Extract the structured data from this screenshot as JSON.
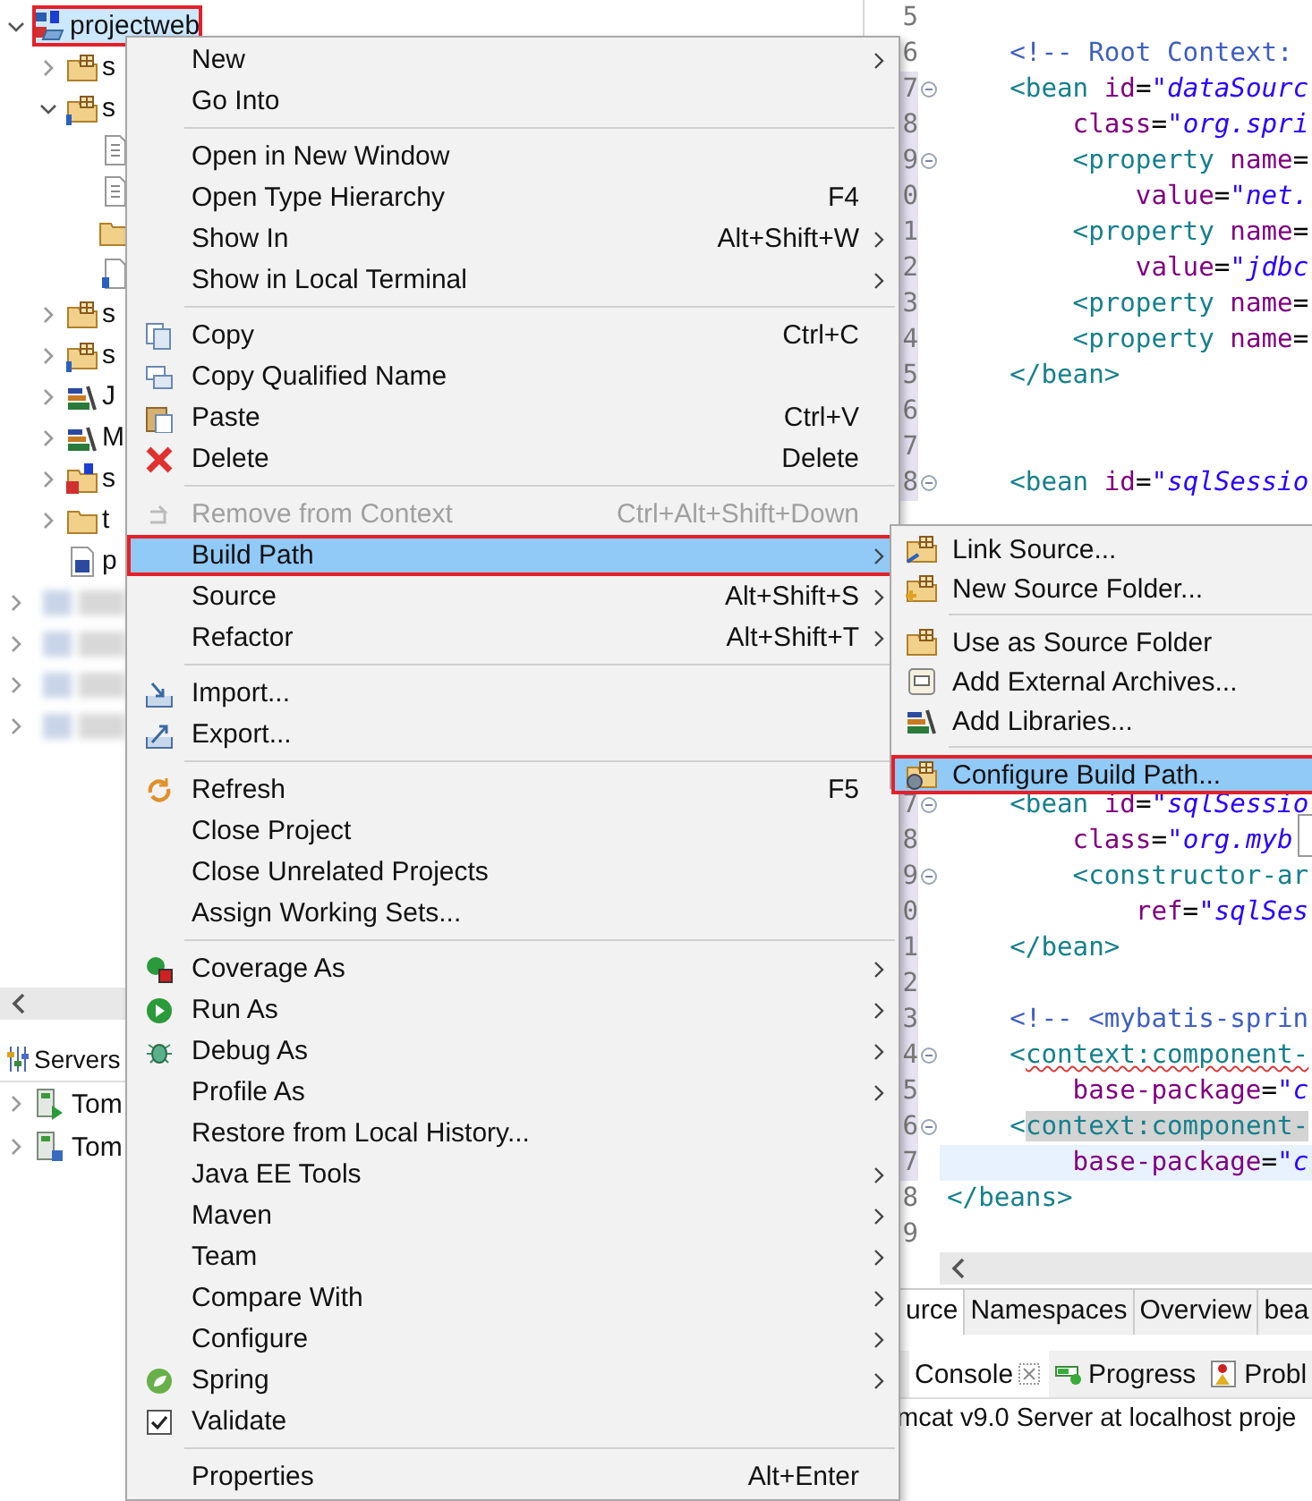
{
  "project_explorer": {
    "tree": [
      {
        "label": "projectweb",
        "kind": "project",
        "expanded": true,
        "selected": true,
        "outlined": true,
        "children": [
          {
            "label": "s",
            "kind": "package-root",
            "expanded": false
          },
          {
            "label": "s",
            "kind": "package-root-info",
            "expanded": true,
            "children": [
              {
                "kind": "file"
              },
              {
                "kind": "file"
              },
              {
                "kind": "folder"
              },
              {
                "kind": "config-file"
              }
            ]
          },
          {
            "label": "s",
            "kind": "package-root",
            "expanded": false
          },
          {
            "label": "s",
            "kind": "package-root-info",
            "expanded": false
          },
          {
            "label": "J",
            "kind": "library",
            "expanded": false
          },
          {
            "label": "M",
            "kind": "library",
            "expanded": false
          },
          {
            "label": "s",
            "kind": "spring-folder",
            "expanded": false
          },
          {
            "label": "t",
            "kind": "folder",
            "expanded": false
          },
          {
            "label": "p",
            "kind": "pom-file"
          }
        ]
      }
    ],
    "redacted_items": [
      {
        "expanded": false
      },
      {
        "expanded": false
      },
      {
        "expanded": false
      },
      {
        "expanded": false
      }
    ]
  },
  "servers_view": {
    "tab": "Servers",
    "servers": [
      {
        "label": "Tom",
        "kind": "started",
        "expanded": false
      },
      {
        "label": "Tom",
        "kind": "stopped",
        "expanded": false
      }
    ]
  },
  "editor": {
    "lines_top": [
      {
        "number": "5"
      },
      {
        "number": "6",
        "tokens": [
          {
            "kind": "comment",
            "text": "    <!-- Root Context:"
          }
        ]
      },
      {
        "number": "7",
        "fold": true,
        "changed": true,
        "tokens": [
          {
            "kind": "tag",
            "text": "    <bean "
          },
          {
            "kind": "attr",
            "text": "id"
          },
          {
            "kind": "text",
            "text": "="
          },
          {
            "kind": "value",
            "text": "\"dataSourc"
          }
        ]
      },
      {
        "number": "8",
        "changed": true,
        "tokens": [
          {
            "kind": "attr",
            "text": "        class"
          },
          {
            "kind": "text",
            "text": "="
          },
          {
            "kind": "value",
            "text": "\"org.spri"
          }
        ]
      },
      {
        "number": "9",
        "fold": true,
        "changed": true,
        "tokens": [
          {
            "kind": "tag",
            "text": "        <property "
          },
          {
            "kind": "attr",
            "text": "name"
          },
          {
            "kind": "text",
            "text": "="
          }
        ]
      },
      {
        "number": "0",
        "changed": true,
        "tokens": [
          {
            "kind": "attr",
            "text": "            value"
          },
          {
            "kind": "text",
            "text": "="
          },
          {
            "kind": "value",
            "text": "\"net."
          }
        ]
      },
      {
        "number": "1",
        "changed": true,
        "tokens": [
          {
            "kind": "tag",
            "text": "        <property "
          },
          {
            "kind": "attr",
            "text": "name"
          },
          {
            "kind": "text",
            "text": "="
          }
        ]
      },
      {
        "number": "2",
        "changed": true,
        "tokens": [
          {
            "kind": "attr",
            "text": "            value"
          },
          {
            "kind": "text",
            "text": "="
          },
          {
            "kind": "value",
            "text": "\"jdbc"
          }
        ]
      },
      {
        "number": "3",
        "changed": true,
        "tokens": [
          {
            "kind": "tag",
            "text": "        <property "
          },
          {
            "kind": "attr",
            "text": "name"
          },
          {
            "kind": "text",
            "text": "="
          }
        ]
      },
      {
        "number": "4",
        "changed": true,
        "tokens": [
          {
            "kind": "tag",
            "text": "        <property "
          },
          {
            "kind": "attr",
            "text": "name"
          },
          {
            "kind": "text",
            "text": "="
          }
        ]
      },
      {
        "number": "5",
        "changed": true,
        "tokens": [
          {
            "kind": "tag",
            "text": "    </bean>"
          }
        ]
      },
      {
        "number": "6",
        "changed": true
      },
      {
        "number": "7",
        "changed": true
      },
      {
        "number": "8",
        "fold": true,
        "changed": true,
        "tokens": [
          {
            "kind": "tag",
            "text": "    <bean "
          },
          {
            "kind": "attr",
            "text": "id"
          },
          {
            "kind": "text",
            "text": "="
          },
          {
            "kind": "value",
            "text": "\"sqlSessio"
          }
        ]
      }
    ],
    "lines_bottom": [
      {
        "number": "7",
        "fold": true,
        "changed": true,
        "tokens": [
          {
            "kind": "tag",
            "text": "    <bean "
          },
          {
            "kind": "attr",
            "text": "id"
          },
          {
            "kind": "text",
            "text": "="
          },
          {
            "kind": "value",
            "text": "\"sqlSessio"
          }
        ]
      },
      {
        "number": "8",
        "changed": true,
        "tokens": [
          {
            "kind": "attr",
            "text": "        class"
          },
          {
            "kind": "text",
            "text": "="
          },
          {
            "kind": "value",
            "text": "\"org.myb"
          }
        ]
      },
      {
        "number": "9",
        "fold": true,
        "changed": true,
        "tokens": [
          {
            "kind": "tag",
            "text": "        <constructor-ar"
          }
        ]
      },
      {
        "number": "0",
        "changed": true,
        "tokens": [
          {
            "kind": "attr",
            "text": "            ref"
          },
          {
            "kind": "text",
            "text": "="
          },
          {
            "kind": "value",
            "text": "\"sqlSes"
          }
        ]
      },
      {
        "number": "1",
        "changed": true,
        "tokens": [
          {
            "kind": "tag",
            "text": "    </bean>"
          }
        ]
      },
      {
        "number": "2",
        "changed": true
      },
      {
        "number": "3",
        "changed": true,
        "tokens": [
          {
            "kind": "comment",
            "text": "    <!-- <mybatis-sprin"
          }
        ]
      },
      {
        "number": "4",
        "fold": true,
        "changed": true,
        "tokens": [
          {
            "kind": "tag",
            "text": "    <"
          },
          {
            "kind": "tag",
            "text": "context:component-",
            "error": true
          }
        ]
      },
      {
        "number": "5",
        "changed": true,
        "tokens": [
          {
            "kind": "attr",
            "text": "        base-package"
          },
          {
            "kind": "text",
            "text": "="
          },
          {
            "kind": "value",
            "text": "\"c"
          }
        ]
      },
      {
        "number": "6",
        "fold": true,
        "changed": true,
        "tokens": [
          {
            "kind": "tag",
            "text": "    <"
          },
          {
            "kind": "tag",
            "text": "context:component-",
            "occurrence": true
          }
        ]
      },
      {
        "number": "7",
        "changed": true,
        "current": true,
        "tokens": [
          {
            "kind": "attr",
            "text": "        base-package"
          },
          {
            "kind": "text",
            "text": "="
          },
          {
            "kind": "value",
            "text": "\"c"
          }
        ]
      },
      {
        "number": "8",
        "tokens": [
          {
            "kind": "tag",
            "text": "</beans>"
          }
        ]
      },
      {
        "number": "9"
      }
    ],
    "tabs": [
      {
        "label": "urce",
        "selected": true
      },
      {
        "label": "Namespaces",
        "selected": false
      },
      {
        "label": "Overview",
        "selected": false
      },
      {
        "label": "bea",
        "selected": false
      }
    ]
  },
  "console_view": {
    "tabs": [
      {
        "label": "Console",
        "selected": true,
        "closable": true
      },
      {
        "label": "Progress",
        "selected": false
      },
      {
        "label": "Probl",
        "selected": false
      }
    ],
    "output": "mcat v9.0 Server at localhost proje"
  },
  "context_menu": {
    "groups": [
      [
        {
          "label": "New",
          "submenu": true
        },
        {
          "label": "Go Into"
        }
      ],
      [
        {
          "label": "Open in New Window"
        },
        {
          "label": "Open Type Hierarchy",
          "shortcut": "F4"
        },
        {
          "label": "Show In",
          "shortcut": "Alt+Shift+W",
          "submenu": true
        },
        {
          "label": "Show in Local Terminal",
          "submenu": true
        }
      ],
      [
        {
          "label": "Copy",
          "shortcut": "Ctrl+C"
        },
        {
          "label": "Copy Qualified Name"
        },
        {
          "label": "Paste",
          "shortcut": "Ctrl+V"
        },
        {
          "label": "Delete",
          "shortcut": "Delete"
        }
      ],
      [
        {
          "label": "Remove from Context",
          "shortcut": "Ctrl+Alt+Shift+Down",
          "disabled": true
        },
        {
          "label": "Build Path",
          "submenu": true,
          "selected": true,
          "outlined": true
        },
        {
          "label": "Source",
          "shortcut": "Alt+Shift+S",
          "submenu": true
        },
        {
          "label": "Refactor",
          "shortcut": "Alt+Shift+T",
          "submenu": true
        }
      ],
      [
        {
          "label": "Import..."
        },
        {
          "label": "Export..."
        }
      ],
      [
        {
          "label": "Refresh",
          "shortcut": "F5"
        },
        {
          "label": "Close Project"
        },
        {
          "label": "Close Unrelated Projects"
        },
        {
          "label": "Assign Working Sets..."
        }
      ],
      [
        {
          "label": "Coverage As",
          "submenu": true
        },
        {
          "label": "Run As",
          "submenu": true
        },
        {
          "label": "Debug As",
          "submenu": true
        },
        {
          "label": "Profile As",
          "submenu": true
        },
        {
          "label": "Restore from Local History..."
        },
        {
          "label": "Java EE Tools",
          "submenu": true
        },
        {
          "label": "Maven",
          "submenu": true
        },
        {
          "label": "Team",
          "submenu": true
        },
        {
          "label": "Compare With",
          "submenu": true
        },
        {
          "label": "Configure",
          "submenu": true
        },
        {
          "label": "Spring",
          "submenu": true
        },
        {
          "label": "Validate",
          "checked": true
        }
      ],
      [
        {
          "label": "Properties",
          "shortcut": "Alt+Enter"
        }
      ]
    ]
  },
  "build_path_submenu": {
    "groups": [
      [
        {
          "label": "Link Source..."
        },
        {
          "label": "New Source Folder..."
        }
      ],
      [
        {
          "label": "Use as Source Folder"
        },
        {
          "label": "Add External Archives..."
        },
        {
          "label": "Add Libraries..."
        }
      ],
      [
        {
          "label": "Configure Build Path...",
          "selected": true,
          "outlined": true
        }
      ]
    ]
  }
}
